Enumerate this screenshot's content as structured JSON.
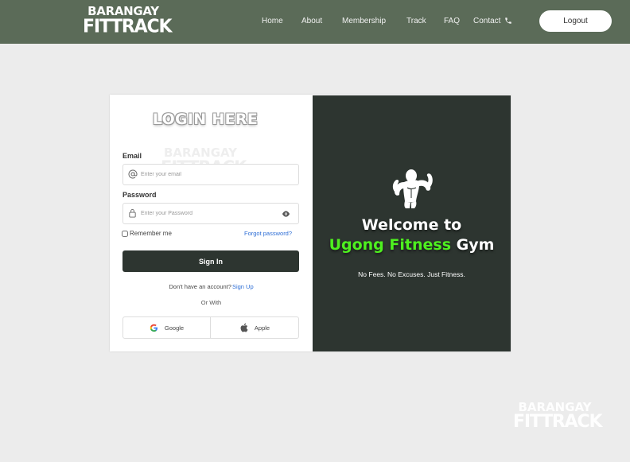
{
  "navbar": {
    "logo_line1": "BARANGAY",
    "logo_line2": "FITTRACK",
    "links": [
      "Home",
      "About",
      "Membership",
      "Track",
      "FAQ",
      "Contact"
    ],
    "logout_label": "Logout",
    "bg_color": "#5b6b58"
  },
  "login": {
    "title": "LOGIN HERE",
    "watermark_line1": "BARANGAY",
    "watermark_line2": "FITTRACK",
    "email_label": "Email",
    "email_placeholder": "Enter your email",
    "password_label": "Password",
    "password_placeholder": "Enter your Password",
    "remember_label": "Remember me",
    "forgot_label": "Forgot password?",
    "signin_label": "Sign In",
    "no_account_text": "Don't have an account?",
    "signup_label": "Sign Up",
    "or_with": "Or With",
    "google_label": "Google",
    "apple_label": "Apple"
  },
  "welcome": {
    "line1": "Welcome to",
    "name_part1": "Ugong",
    "name_part2": "Fitness",
    "name_part3": "Gym",
    "tagline": "No Fees. No Excuses. Just Fitness.",
    "panel_color": "#2d3530",
    "accent_color": "#4ef01f"
  },
  "footer_watermark": {
    "line1": "BARANGAY",
    "line2": "FITTRACK"
  }
}
